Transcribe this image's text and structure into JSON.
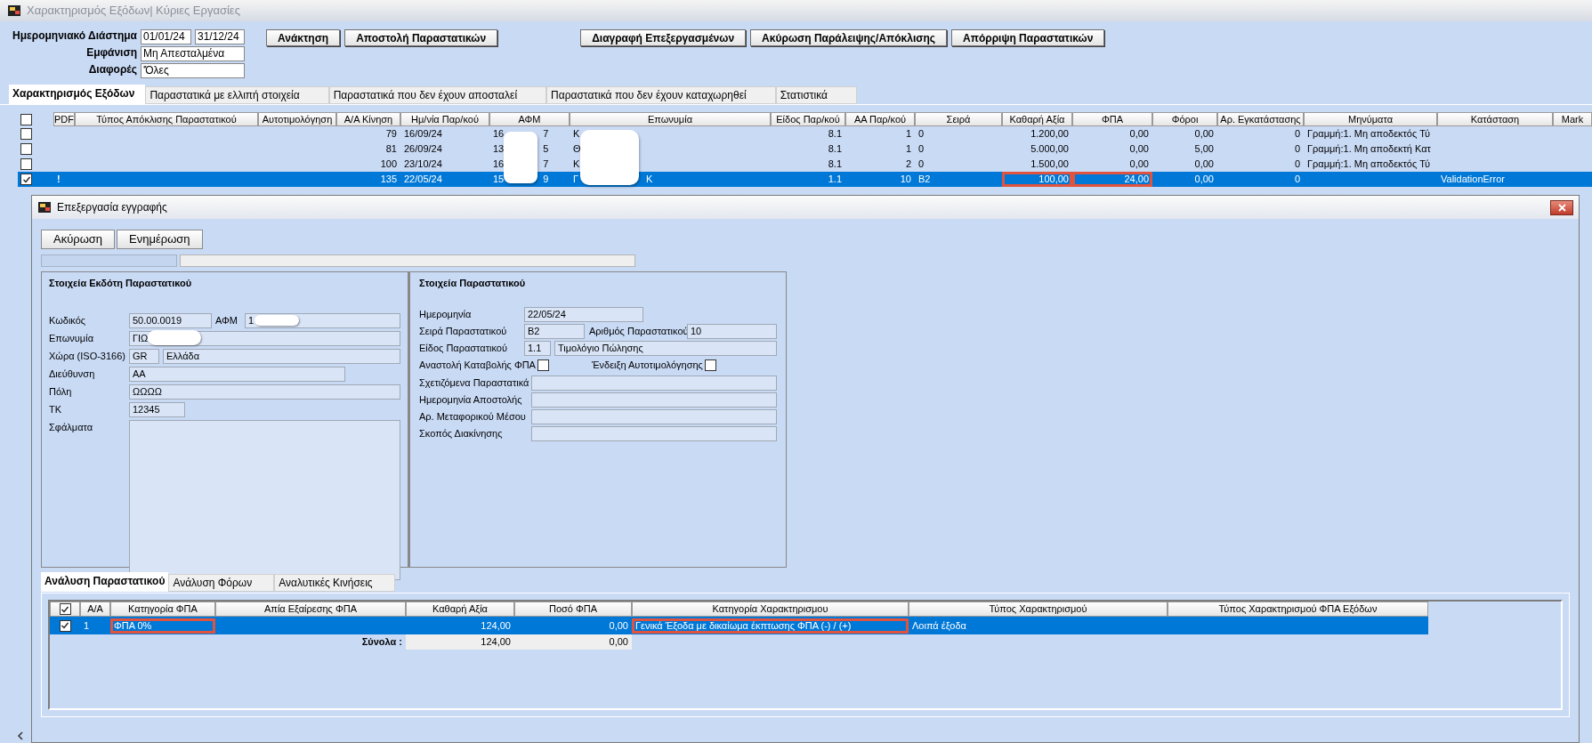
{
  "window": {
    "title": "Χαρακτηρισμός Εξόδων| Κύριες Εργασίες"
  },
  "filters": {
    "range_label": "Ημερομηνιακό Διάστημα",
    "date_from": "01/01/24",
    "date_to": "31/12/24",
    "view_label": "Εμφάνιση",
    "view": "Μη Απεσταλμένα",
    "diff_label": "Διαφορές",
    "diff": "'Όλες"
  },
  "buttons_left": [
    "Ανάκτηση",
    "Αποστολή Παραστατικών"
  ],
  "buttons_right": [
    "Διαγραφή Επεξεργασμένων",
    "Ακύρωση Παράλειψης/Απόκλισης",
    "Απόρριψη Παραστατικών"
  ],
  "tabs": [
    {
      "label": "Χαρακτηρισμός Εξόδων",
      "selected": true
    },
    {
      "label": "Παραστατικά με ελλιπή στοιχεία",
      "selected": false
    },
    {
      "label": "Παραστατικά που δεν έχουν αποσταλεί",
      "selected": false
    },
    {
      "label": "Παραστατικά που δεν έχουν καταχωρηθεί",
      "selected": false
    },
    {
      "label": "Στατιστικά",
      "selected": false
    }
  ],
  "table": {
    "header_checked": false,
    "columns": [
      "PDF",
      "Τύπος Απόκλισης Παραστατικού",
      "Αυτοτιμολόγηση",
      "Α/Α Κίνηση",
      "Ημ/νία Παρ/κού",
      "ΑΦΜ",
      "Επωνυμία",
      "Είδος Παρ/κού",
      "ΑΑ Παρ/κού",
      "Σειρά",
      "Καθαρή Αξία",
      "ΦΠΑ",
      "Φόροι",
      "Αρ. Εγκατάστασης",
      "Μηνύματα",
      "Κατάσταση",
      "Mark"
    ],
    "rows": [
      {
        "checked": false,
        "selected": false,
        "cells": [
          "",
          "",
          "",
          "79",
          "16/09/24",
          {
            "start": "16",
            "end": "7"
          },
          {
            "start": "Κ"
          },
          "8.1",
          "1",
          "0",
          "1.200,00",
          "0,00",
          "0,00",
          "0",
          "Γραμμή:1. Μη αποδεκτός Τύ",
          "",
          ""
        ]
      },
      {
        "checked": false,
        "selected": false,
        "cells": [
          "",
          "",
          "",
          "81",
          "26/09/24",
          {
            "start": "13",
            "end": "5"
          },
          {
            "start": "Θ"
          },
          "8.1",
          "1",
          "0",
          "5.000,00",
          "0,00",
          "5,00",
          "0",
          "Γραμμή:1. Μη αποδεκτή Κατ",
          "",
          ""
        ]
      },
      {
        "checked": false,
        "selected": false,
        "cells": [
          "",
          "",
          "",
          "100",
          "23/10/24",
          {
            "start": "16",
            "end": "7"
          },
          {
            "start": "Κ"
          },
          "8.1",
          "2",
          "0",
          "1.500,00",
          "0,00",
          "0,00",
          "0",
          "Γραμμή:1. Μη αποδεκτός Τύ",
          "",
          ""
        ]
      },
      {
        "checked": true,
        "selected": true,
        "cells": [
          "!",
          "",
          "",
          "135",
          "22/05/24",
          {
            "start": "15",
            "end": "9"
          },
          {
            "start": "Γ",
            "end": "Κ"
          },
          "1.1",
          "10",
          "B2",
          {
            "value": "100,00",
            "highlighted": true
          },
          {
            "value": "24,00",
            "highlighted": true
          },
          "0,00",
          "0",
          "",
          "ValidationError",
          ""
        ]
      }
    ]
  },
  "dialog": {
    "title": "Επεξεργασία εγγραφής",
    "buttons": [
      "Ακύρωση",
      "Ενημέρωση"
    ],
    "issuer": {
      "title": "Στοιχεία Εκδότη Παραστατικού",
      "code_label": "Κωδικός",
      "code": "50.00.0019",
      "afm_label": "ΑΦΜ",
      "afm": "1",
      "name_label": "Επωνυμία",
      "name": "ΓΙΩ",
      "country_label": "Χώρα (ISO-3166)",
      "country_code": "GR",
      "country_name": "Ελλάδα",
      "address_label": "Διεύθυνση",
      "address": "ΑΑ",
      "city_label": "Πόλη",
      "city": "ΩΩΩΩ",
      "zip_label": "ΤΚ",
      "zip": "12345",
      "errors_label": "Σφάλματα"
    },
    "document": {
      "title": "Στοιχεία Παραστατικού",
      "date_label": "Ημερομηνία",
      "date": "22/05/24",
      "series_label": "Σειρά Παραστατικού",
      "series": "B2",
      "number_label": "Αριθμός Παραστατικού",
      "number": "10",
      "type_label": "Είδος Παραστατικού",
      "type_code": "1.1",
      "type_name": "Τιμολόγιο Πώλησης",
      "vat_suspension": {
        "label": "Αναστολή Καταβολής ΦΠΑ",
        "checked": false
      },
      "self_billing": {
        "label": "Ένδειξη Αυτοτιμολόγησης",
        "checked": false
      },
      "related_label": "Σχετιζόμενα Παραστατικά",
      "send_date_label": "Ημερομηνία Αποστολής",
      "vehicle_label": "Αρ. Μεταφορικού Μέσου",
      "purpose_label": "Σκοπός Διακίνησης"
    },
    "tabs": [
      {
        "label": "Ανάλυση Παραστατικού",
        "selected": true
      },
      {
        "label": "Ανάλυση Φόρων",
        "selected": false
      },
      {
        "label": "Αναλυτικές Κινήσεις",
        "selected": false
      }
    ],
    "grid": {
      "header_checked": true,
      "columns": [
        "Α/Α",
        "Κατηγορία ΦΠΑ",
        "Απία Εξαίρεσης ΦΠΑ",
        "Καθαρή Αξία",
        "Ποσό ΦΠΑ",
        "Κατηγορία Χαρακτηρισμου",
        "Τύπος Χαρακτηρισμού",
        "Τύπος Χαρακτηρισμού ΦΠΑ Εξόδων"
      ],
      "rows": [
        {
          "checked": true,
          "selected": true,
          "cells": [
            "1",
            {
              "value": "ΦΠΑ  0%",
              "highlighted": true
            },
            "",
            "124,00",
            "0,00",
            {
              "value": "Γενικά Έξοδα με δικαίωμα έκπτωσης ΦΠΑ (-) / (+)",
              "highlighted": true
            },
            "Λοιπά έξοδα",
            ""
          ]
        }
      ],
      "totals": {
        "label": "Σύνολα :",
        "net": "124,00",
        "vat": "0,00"
      }
    }
  }
}
